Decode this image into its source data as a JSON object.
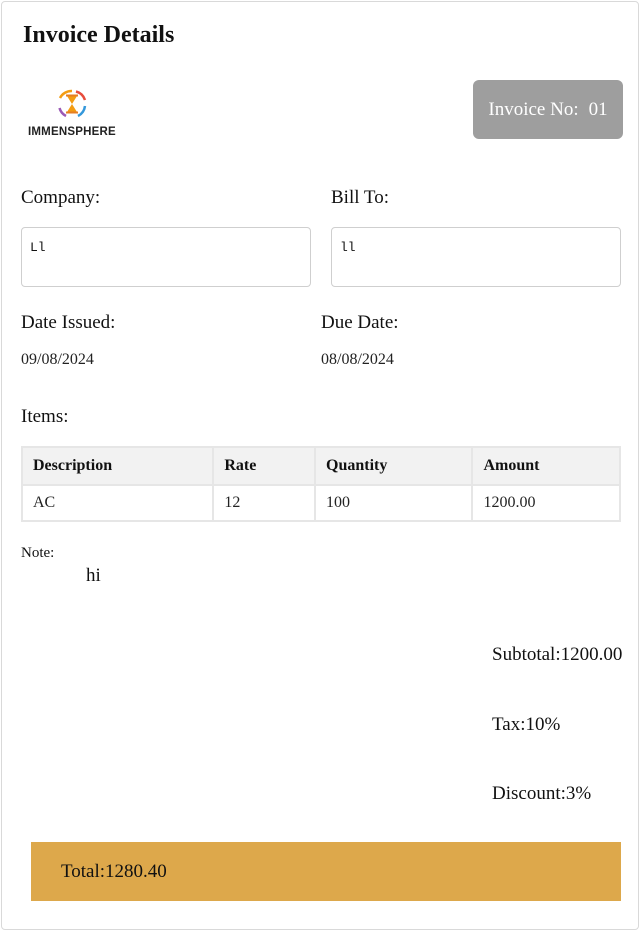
{
  "header": {
    "title": "Invoice Details"
  },
  "logo": {
    "text": "IMMENSPHERE",
    "icon": "hourglass-ring-logo"
  },
  "invoice": {
    "label": "Invoice No:",
    "number": "01"
  },
  "company": {
    "label": "Company:",
    "value": "Ll"
  },
  "bill_to": {
    "label": "Bill To:",
    "value": "ll"
  },
  "dates": {
    "issued_label": "Date Issued:",
    "issued_value": "09/08/2024",
    "due_label": "Due Date:",
    "due_value": "08/08/2024"
  },
  "items": {
    "label": "Items:",
    "columns": [
      "Description",
      "Rate",
      "Quantity",
      "Amount"
    ],
    "rows": [
      [
        "AC",
        "12",
        "100",
        "1200.00"
      ]
    ]
  },
  "note": {
    "label": "Note:",
    "value": "hi"
  },
  "summary": {
    "subtotal": "Subtotal:1200.00",
    "tax": "Tax:10%",
    "discount": "Discount:3%",
    "total": "Total:1280.40"
  },
  "colors": {
    "invoice_badge": "#9e9e9e",
    "total_bar": "#dda84b",
    "logo_orange": "#f39c12"
  }
}
